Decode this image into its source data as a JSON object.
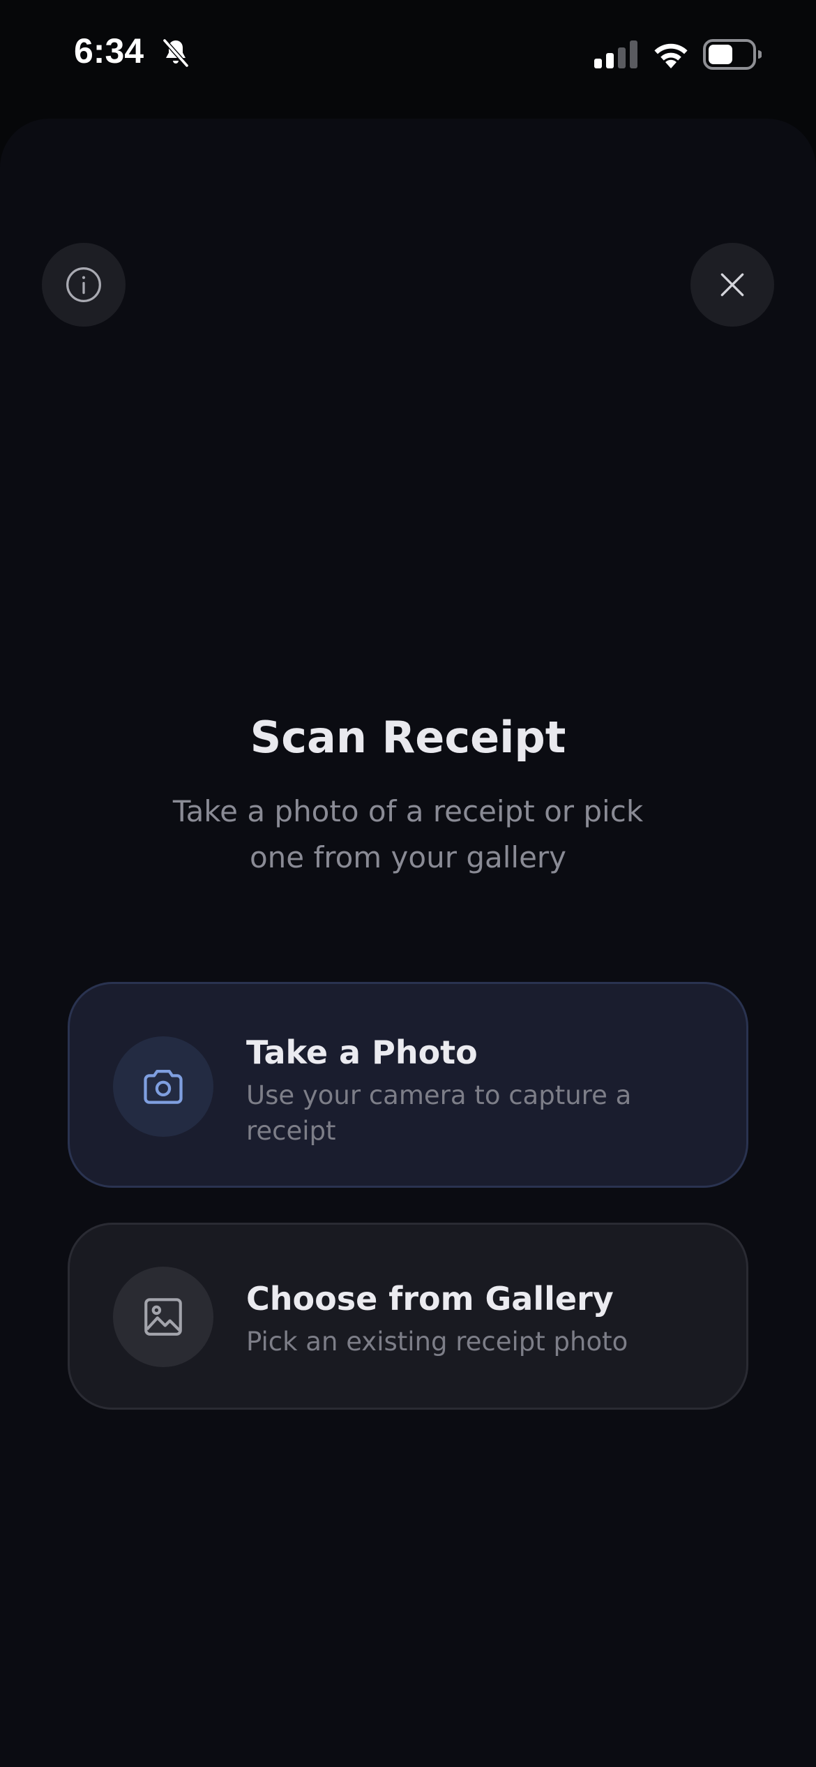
{
  "status_bar": {
    "time": "6:34",
    "icons": [
      "bell-slash-icon",
      "cellular-signal-icon",
      "wifi-icon",
      "battery-icon"
    ]
  },
  "header": {
    "info_icon": "info-circle-icon",
    "close_icon": "close-icon"
  },
  "main": {
    "title": "Scan Receipt",
    "subtitle": "Take a photo of a receipt or pick one from your gallery"
  },
  "options": [
    {
      "icon": "camera-icon",
      "title": "Take a Photo",
      "description": "Use your camera to capture a receipt"
    },
    {
      "icon": "image-icon",
      "title": "Choose from Gallery",
      "description": "Pick an existing receipt photo"
    }
  ],
  "colors": {
    "background": "#0b0c12",
    "accent": "#7f9fe0",
    "primary_card": "#1a1d2e",
    "secondary_card": "#191a21"
  }
}
